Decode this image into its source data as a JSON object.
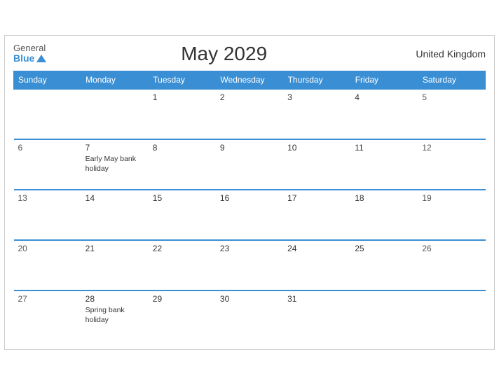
{
  "header": {
    "logo_general": "General",
    "logo_blue": "Blue",
    "title": "May 2029",
    "region": "United Kingdom"
  },
  "weekdays": [
    "Sunday",
    "Monday",
    "Tuesday",
    "Wednesday",
    "Thursday",
    "Friday",
    "Saturday"
  ],
  "weeks": [
    [
      {
        "day": "",
        "empty": true
      },
      {
        "day": "",
        "empty": true
      },
      {
        "day": "1",
        "events": []
      },
      {
        "day": "2",
        "events": []
      },
      {
        "day": "3",
        "events": []
      },
      {
        "day": "4",
        "events": []
      },
      {
        "day": "5",
        "events": []
      }
    ],
    [
      {
        "day": "6",
        "events": []
      },
      {
        "day": "7",
        "events": [
          "Early May bank holiday"
        ]
      },
      {
        "day": "8",
        "events": []
      },
      {
        "day": "9",
        "events": []
      },
      {
        "day": "10",
        "events": []
      },
      {
        "day": "11",
        "events": []
      },
      {
        "day": "12",
        "events": []
      }
    ],
    [
      {
        "day": "13",
        "events": []
      },
      {
        "day": "14",
        "events": []
      },
      {
        "day": "15",
        "events": []
      },
      {
        "day": "16",
        "events": []
      },
      {
        "day": "17",
        "events": []
      },
      {
        "day": "18",
        "events": []
      },
      {
        "day": "19",
        "events": []
      }
    ],
    [
      {
        "day": "20",
        "events": []
      },
      {
        "day": "21",
        "events": []
      },
      {
        "day": "22",
        "events": []
      },
      {
        "day": "23",
        "events": []
      },
      {
        "day": "24",
        "events": []
      },
      {
        "day": "25",
        "events": []
      },
      {
        "day": "26",
        "events": []
      }
    ],
    [
      {
        "day": "27",
        "events": []
      },
      {
        "day": "28",
        "events": [
          "Spring bank holiday"
        ]
      },
      {
        "day": "29",
        "events": []
      },
      {
        "day": "30",
        "events": []
      },
      {
        "day": "31",
        "events": []
      },
      {
        "day": "",
        "empty": true
      },
      {
        "day": "",
        "empty": true
      }
    ]
  ]
}
